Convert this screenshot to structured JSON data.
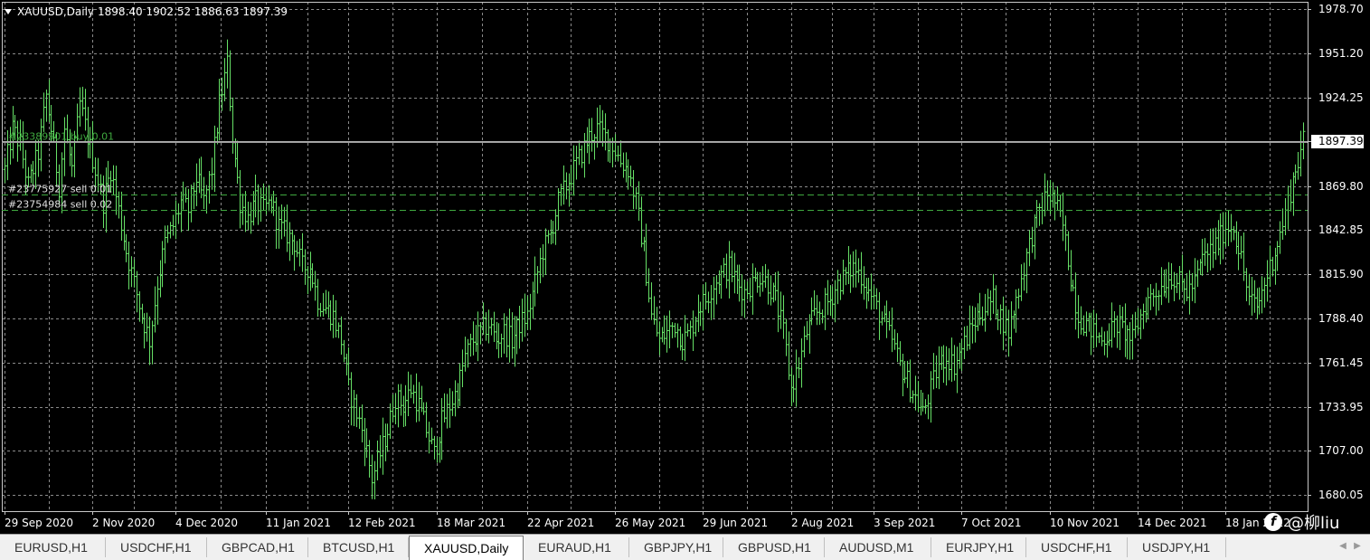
{
  "header": {
    "symbol": "XAUUSD,Daily",
    "ohlc": "1898.40 1902.52 1886.63 1897.39"
  },
  "chart_data": {
    "type": "bar",
    "symbol": "XAUUSD",
    "timeframe": "Daily",
    "y_range": [
      1670,
      1983
    ],
    "y_ticks": [
      1978.7,
      1951.2,
      1924.25,
      1897.39,
      1869.8,
      1842.85,
      1815.9,
      1788.4,
      1761.45,
      1733.95,
      1707.0,
      1680.05
    ],
    "y_tick_labels": [
      "1978.70",
      "1951.20",
      "1924.25",
      "1897.39",
      "1869.80",
      "1842.85",
      "1815.90",
      "1788.40",
      "1761.45",
      "1733.95",
      "1707.00",
      "1680.05"
    ],
    "current_price": 1897.39,
    "current_price_label": "1897.39",
    "x_tick_labels": [
      "29 Sep 2020",
      "2 Nov 2020",
      "4 Dec 2020",
      "11 Jan 2021",
      "12 Feb 2021",
      "18 Mar 2021",
      "22 Apr 2021",
      "26 May 2021",
      "29 Jun 2021",
      "2 Aug 2021",
      "3 Sep 2021",
      "7 Oct 2021",
      "10 Nov 2021",
      "14 Dec 2021",
      "18 Jan 2022"
    ],
    "grid": true,
    "bar_color": "#66e066",
    "grid_color": "#8a8a8a",
    "price_anchors": [
      [
        0,
        1880
      ],
      [
        3,
        1905
      ],
      [
        6,
        1895
      ],
      [
        9,
        1870
      ],
      [
        13,
        1890
      ],
      [
        16,
        1925
      ],
      [
        18,
        1905
      ],
      [
        21,
        1870
      ],
      [
        23,
        1905
      ],
      [
        26,
        1880
      ],
      [
        29,
        1920
      ],
      [
        32,
        1900
      ],
      [
        35,
        1880
      ],
      [
        38,
        1860
      ],
      [
        41,
        1880
      ],
      [
        44,
        1855
      ],
      [
        47,
        1830
      ],
      [
        50,
        1810
      ],
      [
        53,
        1790
      ],
      [
        56,
        1775
      ],
      [
        59,
        1810
      ],
      [
        62,
        1835
      ],
      [
        65,
        1845
      ],
      [
        68,
        1860
      ],
      [
        71,
        1855
      ],
      [
        74,
        1875
      ],
      [
        77,
        1860
      ],
      [
        80,
        1880
      ],
      [
        83,
        1920
      ],
      [
        86,
        1945
      ],
      [
        88,
        1900
      ],
      [
        91,
        1860
      ],
      [
        94,
        1850
      ],
      [
        97,
        1860
      ],
      [
        100,
        1855
      ],
      [
        103,
        1860
      ],
      [
        106,
        1845
      ],
      [
        109,
        1840
      ],
      [
        112,
        1835
      ],
      [
        115,
        1820
      ],
      [
        118,
        1820
      ],
      [
        121,
        1800
      ],
      [
        124,
        1795
      ],
      [
        127,
        1790
      ],
      [
        130,
        1775
      ],
      [
        133,
        1745
      ],
      [
        136,
        1730
      ],
      [
        139,
        1715
      ],
      [
        142,
        1690
      ],
      [
        145,
        1705
      ],
      [
        148,
        1720
      ],
      [
        151,
        1740
      ],
      [
        154,
        1735
      ],
      [
        157,
        1745
      ],
      [
        160,
        1735
      ],
      [
        163,
        1720
      ],
      [
        166,
        1705
      ],
      [
        169,
        1725
      ],
      [
        172,
        1735
      ],
      [
        175,
        1745
      ],
      [
        178,
        1765
      ],
      [
        181,
        1775
      ],
      [
        184,
        1780
      ],
      [
        187,
        1785
      ],
      [
        190,
        1775
      ],
      [
        193,
        1780
      ],
      [
        196,
        1775
      ],
      [
        199,
        1785
      ],
      [
        202,
        1790
      ],
      [
        205,
        1810
      ],
      [
        208,
        1830
      ],
      [
        211,
        1840
      ],
      [
        214,
        1860
      ],
      [
        217,
        1870
      ],
      [
        220,
        1880
      ],
      [
        223,
        1890
      ],
      [
        226,
        1900
      ],
      [
        229,
        1905
      ],
      [
        232,
        1900
      ],
      [
        235,
        1895
      ],
      [
        238,
        1885
      ],
      [
        241,
        1880
      ],
      [
        244,
        1860
      ],
      [
        247,
        1830
      ],
      [
        250,
        1790
      ],
      [
        253,
        1775
      ],
      [
        256,
        1780
      ],
      [
        259,
        1785
      ],
      [
        262,
        1775
      ],
      [
        265,
        1780
      ],
      [
        268,
        1795
      ],
      [
        271,
        1800
      ],
      [
        274,
        1810
      ],
      [
        277,
        1815
      ],
      [
        280,
        1820
      ],
      [
        283,
        1810
      ],
      [
        286,
        1805
      ],
      [
        289,
        1810
      ],
      [
        292,
        1815
      ],
      [
        295,
        1810
      ],
      [
        298,
        1800
      ],
      [
        301,
        1780
      ],
      [
        304,
        1745
      ],
      [
        307,
        1760
      ],
      [
        310,
        1780
      ],
      [
        313,
        1790
      ],
      [
        316,
        1795
      ],
      [
        319,
        1800
      ],
      [
        322,
        1810
      ],
      [
        325,
        1815
      ],
      [
        328,
        1820
      ],
      [
        331,
        1815
      ],
      [
        334,
        1805
      ],
      [
        337,
        1795
      ],
      [
        340,
        1785
      ],
      [
        343,
        1775
      ],
      [
        346,
        1760
      ],
      [
        349,
        1750
      ],
      [
        352,
        1740
      ],
      [
        355,
        1730
      ],
      [
        358,
        1745
      ],
      [
        361,
        1760
      ],
      [
        364,
        1765
      ],
      [
        367,
        1760
      ],
      [
        370,
        1770
      ],
      [
        373,
        1780
      ],
      [
        376,
        1790
      ],
      [
        379,
        1795
      ],
      [
        382,
        1800
      ],
      [
        385,
        1790
      ],
      [
        388,
        1780
      ],
      [
        391,
        1800
      ],
      [
        394,
        1820
      ],
      [
        397,
        1840
      ],
      [
        400,
        1855
      ],
      [
        403,
        1865
      ],
      [
        406,
        1860
      ],
      [
        409,
        1845
      ],
      [
        412,
        1815
      ],
      [
        415,
        1790
      ],
      [
        418,
        1785
      ],
      [
        421,
        1780
      ],
      [
        424,
        1775
      ],
      [
        427,
        1780
      ],
      [
        430,
        1785
      ],
      [
        433,
        1780
      ],
      [
        436,
        1775
      ],
      [
        439,
        1790
      ],
      [
        442,
        1800
      ],
      [
        445,
        1805
      ],
      [
        448,
        1810
      ],
      [
        451,
        1815
      ],
      [
        454,
        1810
      ],
      [
        457,
        1805
      ],
      [
        460,
        1810
      ],
      [
        463,
        1825
      ],
      [
        466,
        1830
      ],
      [
        469,
        1835
      ],
      [
        472,
        1845
      ],
      [
        475,
        1845
      ],
      [
        478,
        1825
      ],
      [
        481,
        1800
      ],
      [
        484,
        1795
      ],
      [
        487,
        1810
      ],
      [
        490,
        1825
      ],
      [
        493,
        1840
      ],
      [
        496,
        1860
      ],
      [
        499,
        1880
      ],
      [
        502,
        1897
      ]
    ],
    "tick_bar_indices": [
      0,
      34,
      66,
      101,
      133,
      167,
      202,
      236,
      270,
      304,
      336,
      370,
      404,
      438,
      472
    ],
    "total_bars": 503,
    "orders": [
      {
        "label": "#23389901 buy 0.01",
        "price": 1897.0,
        "style": "solid"
      },
      {
        "label": "#23775927 sell 0.01",
        "price": 1864.5,
        "style": "dashed"
      },
      {
        "label": "#23754984 sell 0.02",
        "price": 1855.0,
        "style": "dashed"
      }
    ]
  },
  "tabs": [
    {
      "label": "EURUSD,H1",
      "active": false
    },
    {
      "label": "USDCHF,H1",
      "active": false
    },
    {
      "label": "GBPCAD,H1",
      "active": false
    },
    {
      "label": "BTCUSD,H1",
      "active": false
    },
    {
      "label": "XAUUSD,Daily",
      "active": true
    },
    {
      "label": "EURAUD,H1",
      "active": false
    },
    {
      "label": "GBPJPY,H1",
      "active": false
    },
    {
      "label": "GBPUSD,H1",
      "active": false
    },
    {
      "label": "AUDUSD,M1",
      "active": false
    },
    {
      "label": "EURJPY,H1",
      "active": false
    },
    {
      "label": "USDCHF,H1",
      "active": false
    },
    {
      "label": "USDJPY,H1",
      "active": false
    }
  ],
  "watermark": {
    "text": "@柳liu",
    "logo": "f"
  }
}
